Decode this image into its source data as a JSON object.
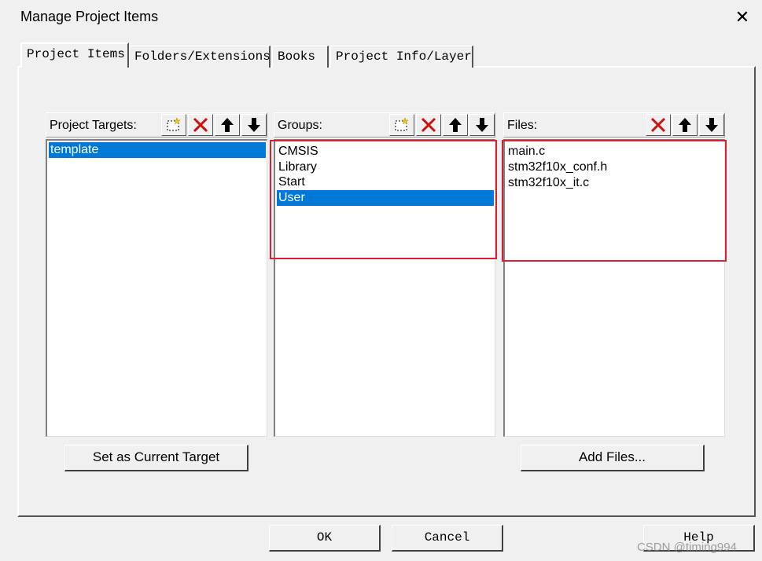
{
  "window": {
    "title": "Manage Project Items",
    "close_glyph": "✕"
  },
  "tabs": [
    {
      "label": "Project Items",
      "active": true
    },
    {
      "label": "Folders/Extensions",
      "active": false
    },
    {
      "label": "Books",
      "active": false
    },
    {
      "label": "Project Info/Layer",
      "active": false
    }
  ],
  "targets": {
    "label": "Project Targets:",
    "items": [
      "template"
    ],
    "selected": "template",
    "tools": [
      "new-icon",
      "delete-icon",
      "move-up-icon",
      "move-down-icon"
    ]
  },
  "groups": {
    "label": "Groups:",
    "items": [
      "CMSIS",
      "Library",
      "Start",
      "User"
    ],
    "selected": "User",
    "tools": [
      "new-icon",
      "delete-icon",
      "move-up-icon",
      "move-down-icon"
    ]
  },
  "files": {
    "label": "Files:",
    "items": [
      "main.c",
      "stm32f10x_conf.h",
      "stm32f10x_it.c"
    ],
    "tools": [
      "delete-icon",
      "move-up-icon",
      "move-down-icon"
    ]
  },
  "buttons": {
    "set_current_target": "Set as Current Target",
    "add_files": "Add Files...",
    "ok": "OK",
    "cancel": "Cancel",
    "help": "Help"
  },
  "watermark": "CSDN @timing994",
  "colors": {
    "selection": "#0078d7",
    "highlight_box": "#d9202f",
    "delete_icon": "#cc1010"
  }
}
